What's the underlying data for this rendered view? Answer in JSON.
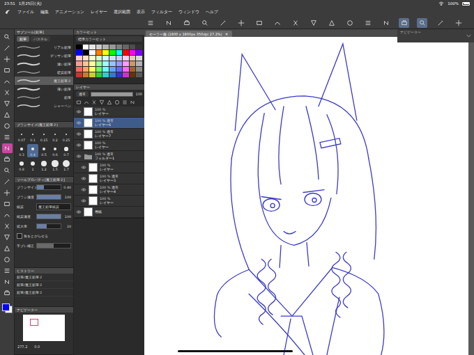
{
  "status_bar": {
    "time": "23:51",
    "date": "1月25日(火)",
    "battery": "100%",
    "battery_level": 1
  },
  "menu_bar": {
    "items": [
      "ファイル",
      "編集",
      "アニメーション",
      "レイヤー",
      "選択範囲",
      "表示",
      "フィルター",
      "ウィンドウ",
      "ヘルプ"
    ]
  },
  "toolbar": [
    {
      "selected": false
    },
    {
      "selected": false
    },
    {
      "selected": false
    },
    {
      "selected": false
    },
    {
      "selected": false
    },
    {
      "selected": false
    },
    {
      "selected": false
    },
    {
      "selected": false
    },
    {
      "selected": false
    },
    {
      "selected": false
    },
    {
      "selected": false
    },
    {
      "selected": false
    },
    {
      "selected": false
    },
    {
      "selected": false
    },
    {
      "selected": true
    },
    {
      "selected": true
    },
    {
      "selected": false
    },
    {
      "selected": false
    }
  ],
  "tools": [
    {
      "selected": false
    },
    {
      "selected": false
    },
    {
      "selected": false
    },
    {
      "selected": false
    },
    {
      "selected": false
    },
    {
      "selected": false
    },
    {
      "selected": false
    },
    {
      "selected": false
    },
    {
      "selected": false
    },
    {
      "selected": false
    },
    {
      "selected": true
    },
    {
      "selected": false
    },
    {
      "selected": false
    },
    {
      "selected": false
    },
    {
      "selected": false
    },
    {
      "selected": false
    },
    {
      "selected": false
    },
    {
      "selected": false
    },
    {
      "selected": false
    },
    {
      "selected": false
    },
    {
      "selected": false
    },
    {
      "selected": false
    },
    {
      "selected": false
    },
    {
      "selected": false
    }
  ],
  "colors": {
    "main": "#0000ff",
    "sub": "#ffffff"
  },
  "subtool": {
    "title": "サブツール[鉛筆]",
    "tabs": [
      {
        "label": "鉛筆",
        "selected": true
      },
      {
        "label": "パステル",
        "selected": false
      }
    ],
    "items": [
      {
        "name": "リアル鉛筆",
        "selected": false
      },
      {
        "name": "デッサン鉛筆",
        "selected": false
      },
      {
        "name": "濃い鉛筆",
        "selected": false
      },
      {
        "name": "硬質鉛筆",
        "selected": false
      },
      {
        "name": "魔王鉛筆２",
        "selected": true
      },
      {
        "name": "薄い鉛筆",
        "selected": false
      },
      {
        "name": "鉛筆",
        "selected": false
      },
      {
        "name": "シャーペン",
        "selected": false
      }
    ]
  },
  "brush_size": {
    "title": "ブラシサイズ(魔王鉛筆２)",
    "sizes": [
      {
        "label": "0.07",
        "selected": false
      },
      {
        "label": "0.1",
        "selected": false
      },
      {
        "label": "0.15",
        "selected": false
      },
      {
        "label": "0.2",
        "selected": false
      },
      {
        "label": "0.25",
        "selected": false
      },
      {
        "label": "0.3",
        "selected": false
      },
      {
        "label": "0.4",
        "selected": true
      },
      {
        "label": "0.5",
        "selected": false
      },
      {
        "label": "0.6",
        "selected": false
      },
      {
        "label": "0.7",
        "selected": false
      },
      {
        "label": "0.8",
        "selected": false
      },
      {
        "label": "1",
        "selected": false
      },
      {
        "label": "1.2",
        "selected": false
      },
      {
        "label": "1.5",
        "selected": false
      },
      {
        "label": "1.7",
        "selected": false
      }
    ]
  },
  "tool_property": {
    "title": "ツールプロパティ[魔王鉛筆２]",
    "rows": [
      {
        "kind": "slider",
        "label": "ブラシサイズ",
        "value": "0.40",
        "level": 0.3
      },
      {
        "kind": "slider",
        "label": "ブラシ濃度",
        "value": "100",
        "level": 1
      },
      {
        "kind": "select",
        "label": "紙質",
        "value": "魔王鉛筆紙質"
      },
      {
        "kind": "slider",
        "label": "紙質濃度",
        "value": "100",
        "level": 1
      },
      {
        "kind": "slider",
        "label": "拡大率",
        "value": "10",
        "level": 0.4
      },
      {
        "kind": "checkbox",
        "label": "角をとがらせる",
        "checked": false
      },
      {
        "kind": "meter",
        "label": "手ブレ補正",
        "level": 0.5
      }
    ]
  },
  "history": {
    "title": "ヒストリー",
    "items": [
      "鉛筆/魔王鉛筆２",
      "鉛筆/魔王鉛筆２",
      "鉛筆/魔王鉛筆２"
    ]
  },
  "navigator": {
    "title": "ナビゲーター",
    "zoom": "277.2",
    "angle": "0.0"
  },
  "color_set": {
    "title": "カラーセット",
    "preset": "標準カラーセット",
    "swatches": [
      "#000000",
      "#ffffff",
      "#e6e6e6",
      "#cccccc",
      "#b3b3b3",
      "#999999",
      "#808080",
      "#666666",
      "#4d4d4d",
      "#333333",
      "#0000ff",
      "#000000",
      "#ffffff",
      "#ff8000",
      "#ffff00",
      "#00ff00",
      "#00ffff",
      "#ff0000",
      "#ff00ff",
      "#8000ff",
      "#ffcccc",
      "#ffe0cc",
      "#ffffcc",
      "#ccffcc",
      "#ccffff",
      "#cce0ff",
      "#ccccff",
      "#ffccff",
      "#e6ccb3",
      "#d9d9d9",
      "#ff9999",
      "#ffc299",
      "#ffff99",
      "#99ff99",
      "#99ffff",
      "#99c2ff",
      "#9999ff",
      "#ff99ff",
      "#cc9966",
      "#b3b3b3",
      "#ff6666",
      "#ffa366",
      "#ffff66",
      "#66ff66",
      "#66ffff",
      "#66a3ff",
      "#6666ff",
      "#ff66ff",
      "#996633",
      "#8c8c8c",
      "#cc3333",
      "#cc7a33",
      "#cccc33",
      "#33cc33",
      "#33cccc",
      "#337acc",
      "#3333cc",
      "#cc33cc",
      "#663300",
      "#595959"
    ]
  },
  "layers": {
    "title": "レイヤー",
    "blend": "通常",
    "opacity": "100",
    "items": [
      {
        "kind": "layer",
        "opacity": "100 %",
        "mode": "",
        "name": "レイヤー",
        "visible": true,
        "selected": false,
        "in_folder": false
      },
      {
        "kind": "layer",
        "opacity": "100 %",
        "mode": "通常",
        "name": "レイヤー6",
        "visible": true,
        "selected": true,
        "in_folder": false
      },
      {
        "kind": "layer",
        "opacity": "100 %",
        "mode": "通常",
        "name": "レイヤー7",
        "visible": true,
        "selected": false,
        "in_folder": false
      },
      {
        "kind": "layer",
        "opacity": "100 %",
        "mode": "",
        "name": "レイヤー",
        "visible": true,
        "selected": false,
        "in_folder": false
      },
      {
        "kind": "folder",
        "opacity": "100 %",
        "mode": "通常",
        "name": "フォルダー1",
        "visible": true,
        "selected": false,
        "in_folder": false
      },
      {
        "kind": "layer",
        "opacity": "100 %",
        "mode": "",
        "name": "レイヤー",
        "visible": true,
        "selected": false,
        "in_folder": true
      },
      {
        "kind": "layer",
        "opacity": "100 %",
        "mode": "通常",
        "name": "レイヤー3",
        "visible": true,
        "selected": false,
        "in_folder": true
      },
      {
        "kind": "layer",
        "opacity": "100 %",
        "mode": "通常",
        "name": "レイヤー4",
        "visible": true,
        "selected": false,
        "in_folder": true
      },
      {
        "kind": "layer",
        "opacity": "100 %",
        "mode": "",
        "name": "レイヤー",
        "visible": true,
        "selected": false,
        "in_folder": true
      },
      {
        "kind": "paper",
        "opacity": "",
        "mode": "",
        "name": "用紙",
        "visible": true,
        "selected": false,
        "in_folder": false
      }
    ]
  },
  "canvas": {
    "tab": "セーラー服 (1800 x 1800px 350dpi 27.2%)",
    "close": "×"
  },
  "floating_navigator": {
    "title": "ナビゲーター"
  }
}
